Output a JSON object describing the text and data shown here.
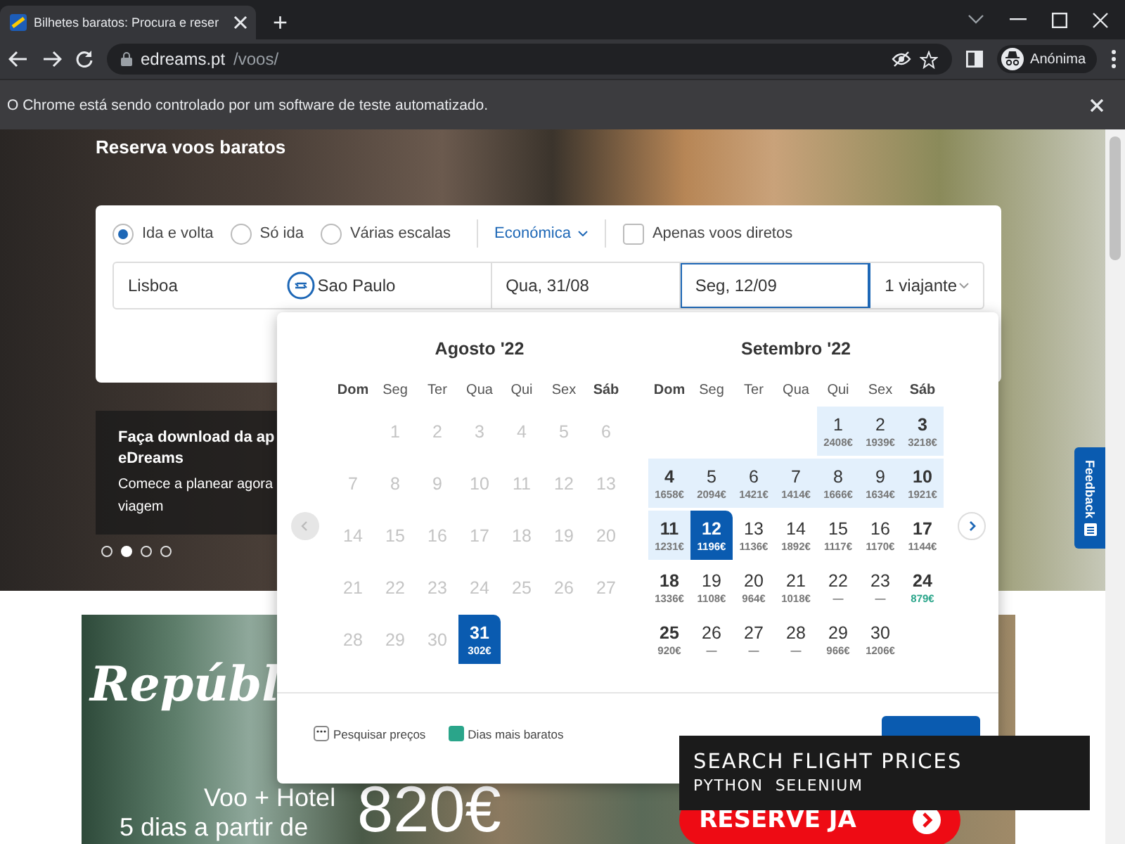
{
  "browser": {
    "tab_title": "Bilhetes baratos: Procura e reser",
    "new_tab": "+",
    "address_host": "edreams.pt",
    "address_path": "/voos/",
    "profile": "Anónima",
    "infobar": "O Chrome está sendo controlado por um software de teste automatizado."
  },
  "hero": {
    "heading": "Reserva voos baratos"
  },
  "search": {
    "trip_types": [
      {
        "label": "Ida e volta",
        "selected": true
      },
      {
        "label": "Só ida",
        "selected": false
      },
      {
        "label": "Várias escalas",
        "selected": false
      }
    ],
    "cabin": "Económica",
    "direct_only": {
      "label": "Apenas voos diretos",
      "checked": false
    },
    "fields": [
      {
        "kind": "origin",
        "value": "Lisboa",
        "focused": false
      },
      {
        "kind": "destination",
        "value": "Sao Paulo",
        "focused": false
      },
      {
        "kind": "date",
        "value": "Qua, 31/08",
        "focused": false
      },
      {
        "kind": "date",
        "value": "Seg, 12/09",
        "focused": true
      },
      {
        "kind": "travellers",
        "value": "1 viajante",
        "focused": false
      }
    ]
  },
  "promo": {
    "title": "Faça download da ap\neDreams",
    "text": "Comece a planear agora\nviagem",
    "dots": [
      {
        "selected": false
      },
      {
        "selected": true
      },
      {
        "selected": false
      },
      {
        "selected": false
      }
    ]
  },
  "calendar": {
    "months": [
      {
        "title": "Agosto '22",
        "weekdays": [
          "Dom",
          "Seg",
          "Ter",
          "Qua",
          "Qui",
          "Sex",
          "Sáb"
        ],
        "weeks": [
          [
            {
              "kind": "blank"
            },
            {
              "kind": "disabled",
              "day": "1"
            },
            {
              "kind": "disabled",
              "day": "2"
            },
            {
              "kind": "disabled",
              "day": "3"
            },
            {
              "kind": "disabled",
              "day": "4"
            },
            {
              "kind": "disabled",
              "day": "5"
            },
            {
              "kind": "disabled",
              "day": "6"
            }
          ],
          [
            {
              "kind": "disabled",
              "day": "7"
            },
            {
              "kind": "disabled",
              "day": "8"
            },
            {
              "kind": "disabled",
              "day": "9"
            },
            {
              "kind": "disabled",
              "day": "10"
            },
            {
              "kind": "disabled",
              "day": "11"
            },
            {
              "kind": "disabled",
              "day": "12"
            },
            {
              "kind": "disabled",
              "day": "13"
            }
          ],
          [
            {
              "kind": "disabled",
              "day": "14"
            },
            {
              "kind": "disabled",
              "day": "15"
            },
            {
              "kind": "disabled",
              "day": "16"
            },
            {
              "kind": "disabled",
              "day": "17"
            },
            {
              "kind": "disabled",
              "day": "18"
            },
            {
              "kind": "disabled",
              "day": "19"
            },
            {
              "kind": "disabled",
              "day": "20"
            }
          ],
          [
            {
              "kind": "disabled",
              "day": "21"
            },
            {
              "kind": "disabled",
              "day": "22"
            },
            {
              "kind": "disabled",
              "day": "23"
            },
            {
              "kind": "disabled",
              "day": "24"
            },
            {
              "kind": "disabled",
              "day": "25"
            },
            {
              "kind": "disabled",
              "day": "26"
            },
            {
              "kind": "disabled",
              "day": "27"
            }
          ],
          [
            {
              "kind": "disabled",
              "day": "28"
            },
            {
              "kind": "disabled",
              "day": "29"
            },
            {
              "kind": "disabled",
              "day": "30"
            },
            {
              "kind": "selected",
              "day": "31",
              "price": "302€"
            },
            {
              "kind": "blank"
            },
            {
              "kind": "blank"
            },
            {
              "kind": "blank"
            }
          ]
        ]
      },
      {
        "title": "Setembro '22",
        "weekdays": [
          "Dom",
          "Seg",
          "Ter",
          "Qua",
          "Qui",
          "Sex",
          "Sáb"
        ],
        "weeks": [
          [
            {
              "kind": "blank"
            },
            {
              "kind": "blank"
            },
            {
              "kind": "blank"
            },
            {
              "kind": "blank"
            },
            {
              "kind": "range",
              "day": "1",
              "price": "2408€"
            },
            {
              "kind": "range",
              "day": "2",
              "price": "1939€"
            },
            {
              "kind": "range",
              "day": "3",
              "price": "3218€"
            }
          ],
          [
            {
              "kind": "range",
              "day": "4",
              "price": "1658€"
            },
            {
              "kind": "range",
              "day": "5",
              "price": "2094€"
            },
            {
              "kind": "range",
              "day": "6",
              "price": "1421€"
            },
            {
              "kind": "range",
              "day": "7",
              "price": "1414€"
            },
            {
              "kind": "range",
              "day": "8",
              "price": "1666€"
            },
            {
              "kind": "range",
              "day": "9",
              "price": "1634€"
            },
            {
              "kind": "range",
              "day": "10",
              "price": "1921€"
            }
          ],
          [
            {
              "kind": "range",
              "day": "11",
              "price": "1231€"
            },
            {
              "kind": "selected",
              "day": "12",
              "price": "1196€"
            },
            {
              "kind": "normal",
              "day": "13",
              "price": "1136€"
            },
            {
              "kind": "normal",
              "day": "14",
              "price": "1892€"
            },
            {
              "kind": "normal",
              "day": "15",
              "price": "1117€"
            },
            {
              "kind": "normal",
              "day": "16",
              "price": "1170€"
            },
            {
              "kind": "normal",
              "day": "17",
              "price": "1144€"
            }
          ],
          [
            {
              "kind": "normal",
              "day": "18",
              "price": "1336€"
            },
            {
              "kind": "normal",
              "day": "19",
              "price": "1108€"
            },
            {
              "kind": "normal",
              "day": "20",
              "price": "964€"
            },
            {
              "kind": "normal",
              "day": "21",
              "price": "1018€"
            },
            {
              "kind": "normal",
              "day": "22",
              "price": "—"
            },
            {
              "kind": "normal",
              "day": "23",
              "price": "—"
            },
            {
              "kind": "cheapest",
              "day": "24",
              "price": "879€"
            }
          ],
          [
            {
              "kind": "normal",
              "day": "25",
              "price": "920€"
            },
            {
              "kind": "normal",
              "day": "26",
              "price": "—"
            },
            {
              "kind": "normal",
              "day": "27",
              "price": "—"
            },
            {
              "kind": "normal",
              "day": "28",
              "price": "—"
            },
            {
              "kind": "normal",
              "day": "29",
              "price": "966€"
            },
            {
              "kind": "normal",
              "day": "30",
              "price": "1206€"
            },
            {
              "kind": "blank"
            }
          ]
        ]
      }
    ],
    "legend": [
      {
        "kind": "search",
        "label": "Pesquisar preços"
      },
      {
        "kind": "cheapest",
        "label": "Dias mais baratos",
        "color": "#2aa58a"
      }
    ]
  },
  "banner": {
    "title": "Repúbl",
    "line_1": "Voo + Hotel",
    "line_2": "5 dias a partir de",
    "price": "820€",
    "button": "RESERVE JA"
  },
  "feedback": "Feedback",
  "caption": {
    "title": "SEARCH FLIGHT PRICES",
    "subtitle": "PYTHON  SELENIUM"
  }
}
